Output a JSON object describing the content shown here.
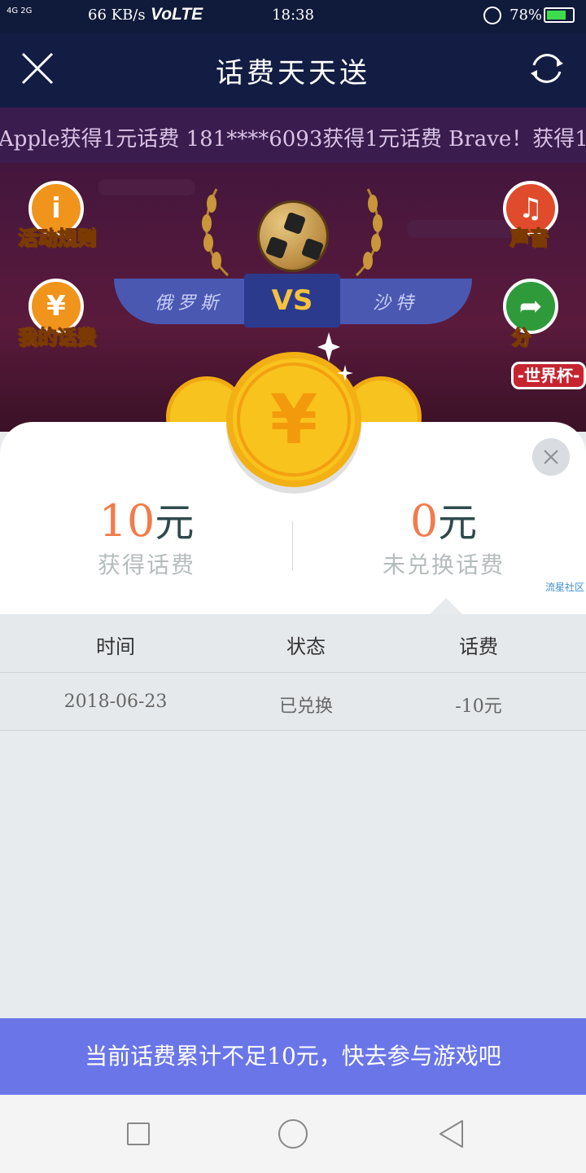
{
  "status_bar": {
    "signal": "4G 2G",
    "net_speed": "66 KB/s",
    "volte": "VoLTE",
    "time": "18:38",
    "battery_pct": "78%",
    "battery_level": 0.78
  },
  "header": {
    "title": "话费天天送"
  },
  "ticker": {
    "text": "Apple获得1元话费   181****6093获得1元话费   Brave！获得1元"
  },
  "game": {
    "rules_label": "活动规则",
    "my_fee_label": "我的话费",
    "sound_label": "声音",
    "share_label": "分",
    "team_left": "俄罗斯",
    "team_right": "沙特",
    "vs": "VS",
    "world_cup_badge": "-世界杯-"
  },
  "coin": {
    "symbol": "¥"
  },
  "summary": {
    "earned_value": "10",
    "earned_unit": "元",
    "earned_label": "获得话费",
    "unredeemed_value": "0",
    "unredeemed_unit": "元",
    "unredeemed_label": "未兑换话费",
    "watermark": "流星社区"
  },
  "table": {
    "headers": [
      "时间",
      "状态",
      "话费"
    ],
    "rows": [
      [
        "2018-06-23",
        "已兑换",
        "-10元"
      ]
    ]
  },
  "footer": {
    "message": "当前话费累计不足10元，快去参与游戏吧"
  },
  "colors": {
    "accent_orange": "#f17c4b",
    "footer_blue": "#6a76e8",
    "coin_gold": "#f8c31d"
  }
}
